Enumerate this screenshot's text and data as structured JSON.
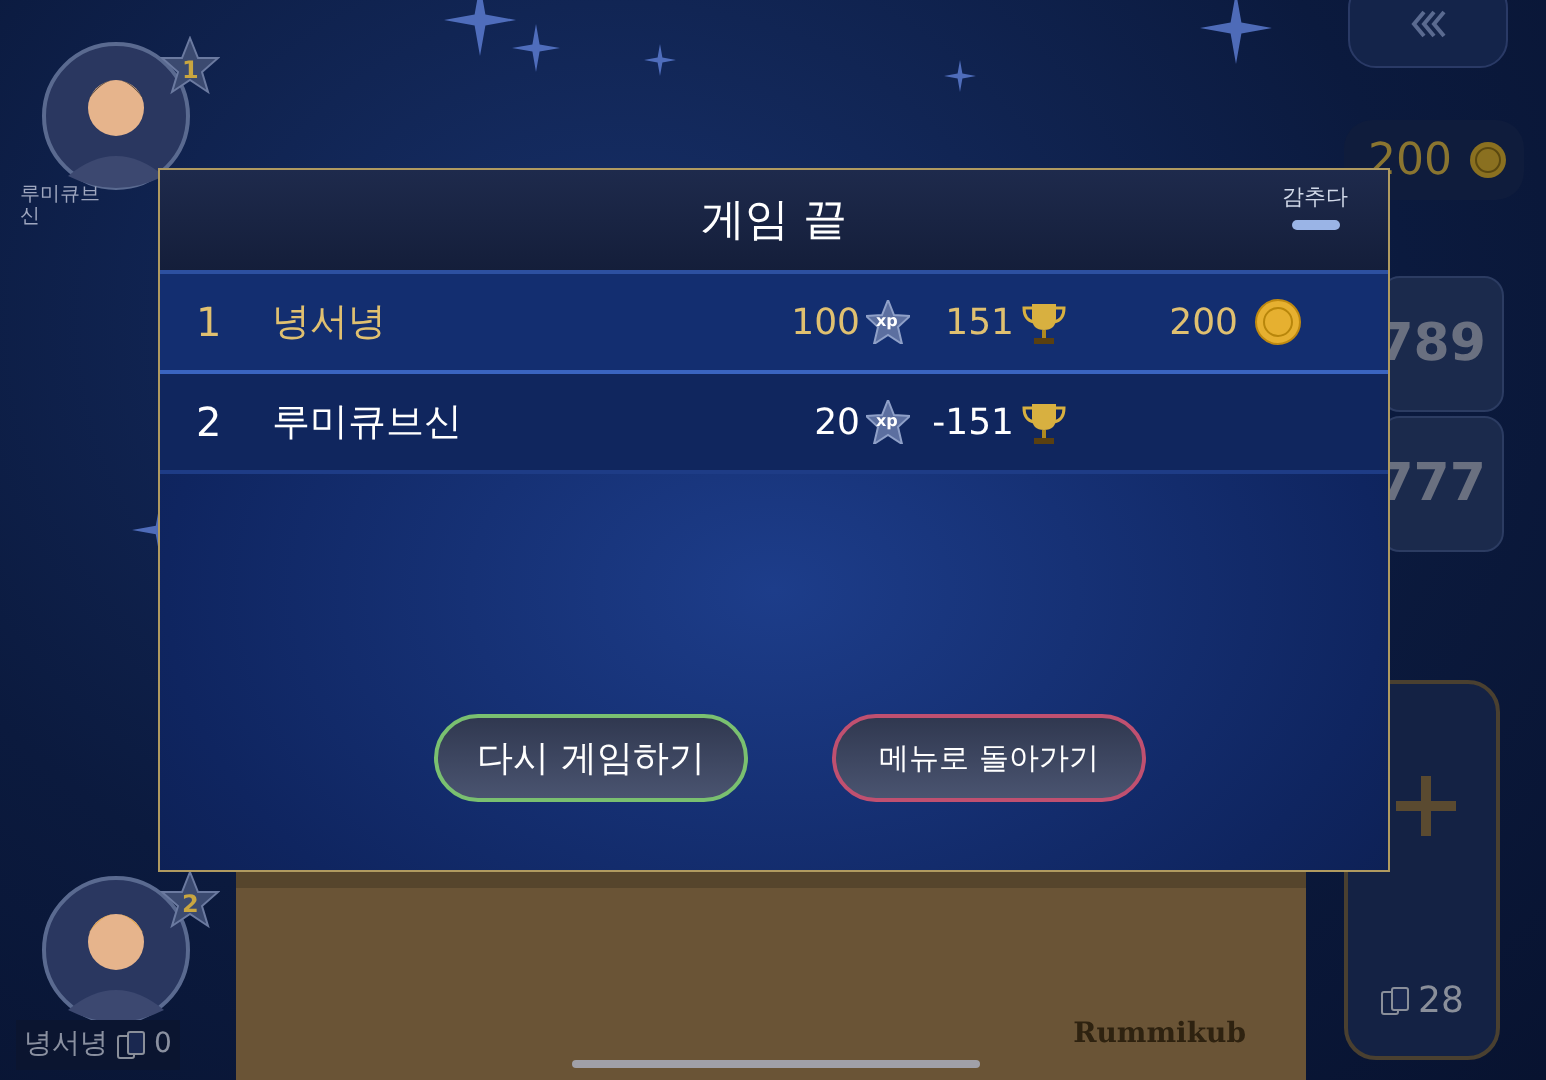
{
  "top_player": {
    "name": "루미큐브신",
    "badge": "1"
  },
  "bottom_player": {
    "name": "녕서녕",
    "badge": "2",
    "tile_count": "0"
  },
  "side": {
    "coins": "200",
    "tiles": [
      "789",
      "777"
    ],
    "pool_count": "28"
  },
  "rack": {
    "logo": "Rummikub"
  },
  "dialog": {
    "title": "게임 끝",
    "hide_label": "감추다",
    "results": [
      {
        "rank": "1",
        "name": "녕서녕",
        "xp": "100",
        "xp_badge": "xp",
        "trophies": "151",
        "coins": "200",
        "highlighted": true
      },
      {
        "rank": "2",
        "name": "루미큐브신",
        "xp": "20",
        "xp_badge": "xp",
        "trophies": "-151",
        "highlighted": false
      }
    ],
    "buttons": [
      {
        "label": "다시 게임하기",
        "kind": "replay"
      },
      {
        "label": "메뉴로 돌아가기",
        "kind": "menu"
      }
    ]
  }
}
